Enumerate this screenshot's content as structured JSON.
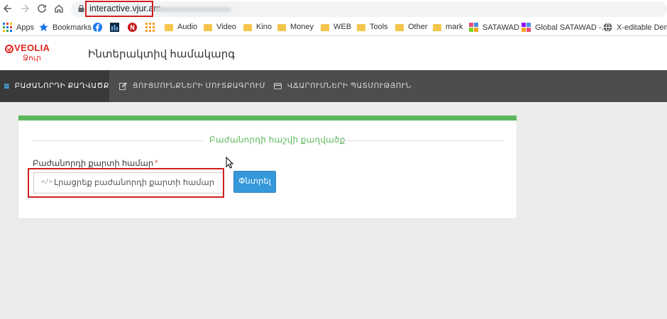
{
  "browser": {
    "url_text": "interactive.vjur.am"
  },
  "bookmarks": [
    {
      "label": "Apps",
      "icon": "apps-grid-icon"
    },
    {
      "label": "Bookmarks",
      "icon": "star-icon"
    },
    {
      "label": "",
      "icon": "facebook-icon"
    },
    {
      "label": "",
      "icon": "site-icon"
    },
    {
      "label": "",
      "icon": "n-icon"
    },
    {
      "label": "",
      "icon": "grid-icon"
    },
    {
      "label": "Audio",
      "icon": "folder-icon"
    },
    {
      "label": "Video",
      "icon": "folder-icon"
    },
    {
      "label": "Kino",
      "icon": "folder-icon"
    },
    {
      "label": "Money",
      "icon": "folder-icon"
    },
    {
      "label": "WEB",
      "icon": "folder-icon"
    },
    {
      "label": "Tools",
      "icon": "folder-icon"
    },
    {
      "label": "Other",
      "icon": "folder-icon"
    },
    {
      "label": "mark",
      "icon": "folder-icon"
    },
    {
      "label": "SATAWAD",
      "icon": "satawad-icon"
    },
    {
      "label": "Global SATAWAD -...",
      "icon": "satawad-icon"
    },
    {
      "label": "X-editable Demo",
      "icon": "globe-icon"
    }
  ],
  "site": {
    "logo_word": "VEOLIA",
    "logo_sub": "Ջուր",
    "title": "Ինտերակտիվ համակարգ"
  },
  "nav": [
    {
      "label": "ԲԱԺԱՆՈՐԴԻ ՔԱՂՎԱԾՔ",
      "icon": "list-icon",
      "active": true
    },
    {
      "label": "ՑՈՒՑՄՈՒՆՔՆԵՐԻ ՄՈՒՏՔԱԳՐՈՒՄ",
      "icon": "edit-icon",
      "active": false
    },
    {
      "label": "ՎՃԱՐՈՒՄՆԵՐԻ ՊԱՏՄՈՒԹՅՈՒՆ",
      "icon": "credit-card-icon",
      "active": false
    }
  ],
  "card": {
    "legend": "Բաժանորդի հաշվի քաղվածք",
    "field_label": "Բաժանորդի քարտի համար",
    "required_mark": "*",
    "input_placeholder": "Լրացրեք բաժանորդի քարտի համար",
    "input_value": "",
    "search_label": "Փնտրել"
  },
  "colors": {
    "accent_green": "#5cb85c",
    "button_blue": "#3498db",
    "nav_bg": "#4d4d4d",
    "brand_red": "#e0261d",
    "highlight_red": "#d21f1f"
  }
}
